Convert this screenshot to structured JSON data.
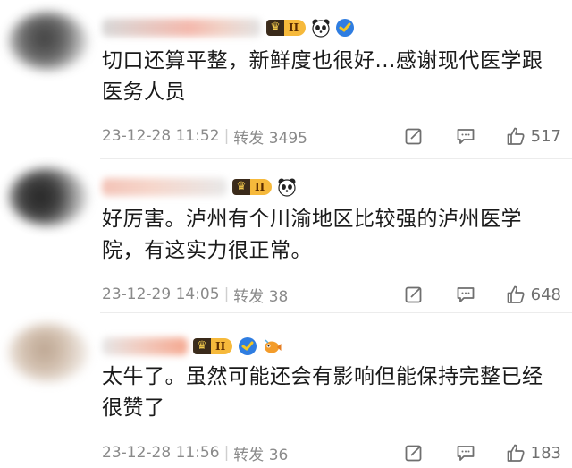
{
  "comments": [
    {
      "level": "II",
      "text": "切口还算平整，新鲜度也很好...感谢现代医学跟医务人员",
      "time": "23-12-28 11:52",
      "forward_label": "转发 3495",
      "likes": "517",
      "icons": [
        "crown-badge-icon",
        "panda-icon",
        "verified-shield-icon"
      ]
    },
    {
      "level": "II",
      "text": "好厉害。泸州有个川渝地区比较强的泸州医学院，有这实力很正常。",
      "time": "23-12-29 14:05",
      "forward_label": "转发 38",
      "likes": "648",
      "icons": [
        "crown-badge-icon",
        "panda-icon"
      ]
    },
    {
      "level": "II",
      "text": "太牛了。虽然可能还会有影响但能保持完整已经很赞了",
      "time": "23-12-28 11:56",
      "forward_label": "转发 36",
      "likes": "183",
      "icons": [
        "crown-badge-icon",
        "verified-shield-icon",
        "fish-icon"
      ]
    }
  ],
  "colors": {
    "text": "#1a1a1a",
    "meta": "#8a8a8a",
    "badge_gold": "#f6b93b",
    "badge_dark": "#3a2a1a",
    "separator": "#ececec"
  }
}
